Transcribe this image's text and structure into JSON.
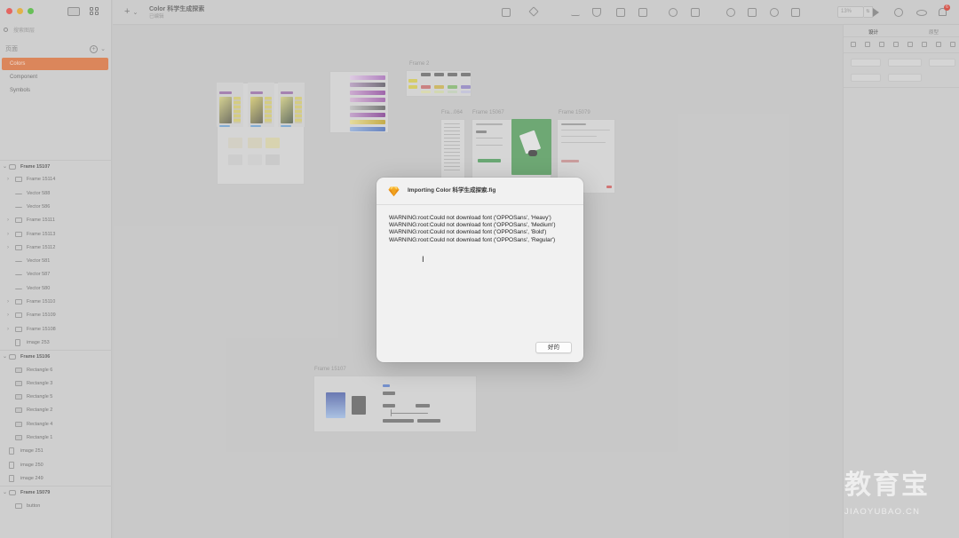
{
  "colors": {
    "accent": "#e07f4e",
    "close": "#ea5b55",
    "minimize": "#e8b13a",
    "maximize": "#5cc04a",
    "badge": "#d94a3f"
  },
  "sidebar": {
    "search_placeholder": "搜索图层",
    "pages_label": "页面",
    "pages": [
      {
        "label": "Colors",
        "active": true
      },
      {
        "label": "Component",
        "active": false
      },
      {
        "label": "Symbols",
        "active": false
      }
    ],
    "layers": [
      {
        "label": "Frame 15107",
        "type": "group",
        "indent": 0
      },
      {
        "label": "Frame 15114",
        "type": "frame",
        "indent": 1,
        "chevron": true
      },
      {
        "label": "Vector 588",
        "type": "vector",
        "indent": 1
      },
      {
        "label": "Vector 586",
        "type": "vector",
        "indent": 1
      },
      {
        "label": "Frame 15111",
        "type": "frame",
        "indent": 1,
        "chevron": true
      },
      {
        "label": "Frame 15113",
        "type": "frame",
        "indent": 1,
        "chevron": true
      },
      {
        "label": "Frame 15112",
        "type": "frame",
        "indent": 1,
        "chevron": true
      },
      {
        "label": "Vector 581",
        "type": "vector",
        "indent": 1
      },
      {
        "label": "Vector 587",
        "type": "vector",
        "indent": 1
      },
      {
        "label": "Vector 580",
        "type": "vector",
        "indent": 1
      },
      {
        "label": "Frame 15110",
        "type": "frame",
        "indent": 1,
        "chevron": true
      },
      {
        "label": "Frame 15109",
        "type": "frame",
        "indent": 1,
        "chevron": true
      },
      {
        "label": "Frame 15108",
        "type": "frame",
        "indent": 1,
        "chevron": true
      },
      {
        "label": "image 253",
        "type": "image",
        "indent": 1
      },
      {
        "label": "Frame 15106",
        "type": "group",
        "indent": 0
      },
      {
        "label": "Rectangle 6",
        "type": "rect",
        "indent": 1
      },
      {
        "label": "Rectangle 3",
        "type": "rect",
        "indent": 1
      },
      {
        "label": "Rectangle 5",
        "type": "rect",
        "indent": 1
      },
      {
        "label": "Rectangle 2",
        "type": "rect",
        "indent": 1
      },
      {
        "label": "Rectangle 4",
        "type": "rect",
        "indent": 1
      },
      {
        "label": "Rectangle 1",
        "type": "rect",
        "indent": 1
      },
      {
        "label": "image 251",
        "type": "image",
        "indent": 0
      },
      {
        "label": "image 250",
        "type": "image",
        "indent": 0
      },
      {
        "label": "image 249",
        "type": "image",
        "indent": 0
      },
      {
        "label": "Frame 15079",
        "type": "group",
        "indent": 0
      },
      {
        "label": "button",
        "type": "frame",
        "indent": 1
      }
    ]
  },
  "toolbar": {
    "doc_title": "Color 科学生成探索",
    "doc_subtitle": "已编辑",
    "zoom": "13%"
  },
  "inspector": {
    "tab_design": "设计",
    "tab_prototype": "原型"
  },
  "canvas": {
    "labels": [
      "Frame 2",
      "Fra...064",
      "Frame 15067",
      "Frame 15079",
      "Frame 15107"
    ]
  },
  "dialog": {
    "title": "Importing Color 科学生成探索.fig",
    "messages": [
      "WARNING:root:Could not download font ('OPPOSans', 'Heavy')",
      "WARNING:root:Could not download font ('OPPOSans', 'Medium')",
      "WARNING:root:Could not download font ('OPPOSans', 'Bold')",
      "WARNING:root:Could not download font ('OPPOSans', 'Regular')"
    ],
    "ok_label": "好的"
  },
  "watermark": {
    "name": "教育宝",
    "url": "JIAOYUBAO.CN"
  }
}
